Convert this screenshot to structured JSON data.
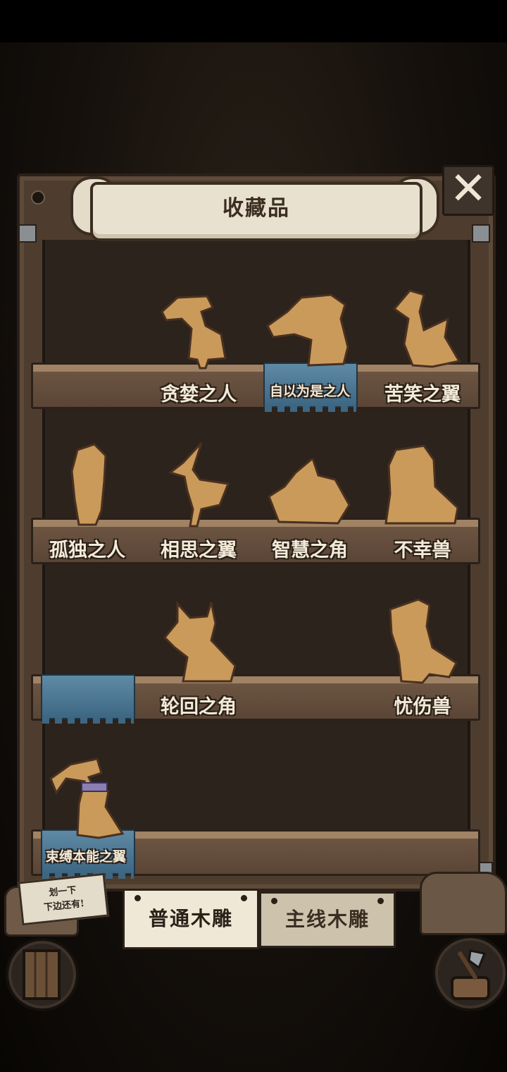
{
  "header": {
    "title": "收藏品",
    "close_label": "✕"
  },
  "shelves": [
    {
      "items": [
        {
          "label": "贪婪之人",
          "icon": "greedy-man-figurine"
        },
        {
          "label": "自以为是之人",
          "icon": "conceited-man-figurine"
        },
        {
          "label": "苦笑之翼",
          "icon": "wry-smile-wing-figurine"
        }
      ]
    },
    {
      "items": [
        {
          "label": "孤独之人",
          "icon": "lonely-man-figurine"
        },
        {
          "label": "相思之翼",
          "icon": "lovesick-wing-figurine"
        },
        {
          "label": "智慧之角",
          "icon": "wisdom-horn-figurine"
        },
        {
          "label": "不幸兽",
          "icon": "unlucky-beast-figurine"
        }
      ]
    },
    {
      "items": [
        {
          "label": "轮回之角",
          "icon": "reincarnation-horn-figurine"
        },
        {
          "label": "忧伤兽",
          "icon": "sorrow-beast-figurine"
        }
      ]
    },
    {
      "items": [
        {
          "label": "束缚本能之翼",
          "icon": "bound-instinct-wing-figurine"
        }
      ]
    }
  ],
  "hint_note": {
    "line1": "划一下",
    "line2": "下边还有!"
  },
  "tabs": {
    "normal": "普通木雕",
    "main": "主线木雕"
  },
  "buttons": {
    "door": "door-icon",
    "axe": "axe-icon"
  },
  "colors": {
    "wood": "#4e3d2f",
    "cloth": "#4f7895",
    "figurine": "#c99a5a"
  }
}
